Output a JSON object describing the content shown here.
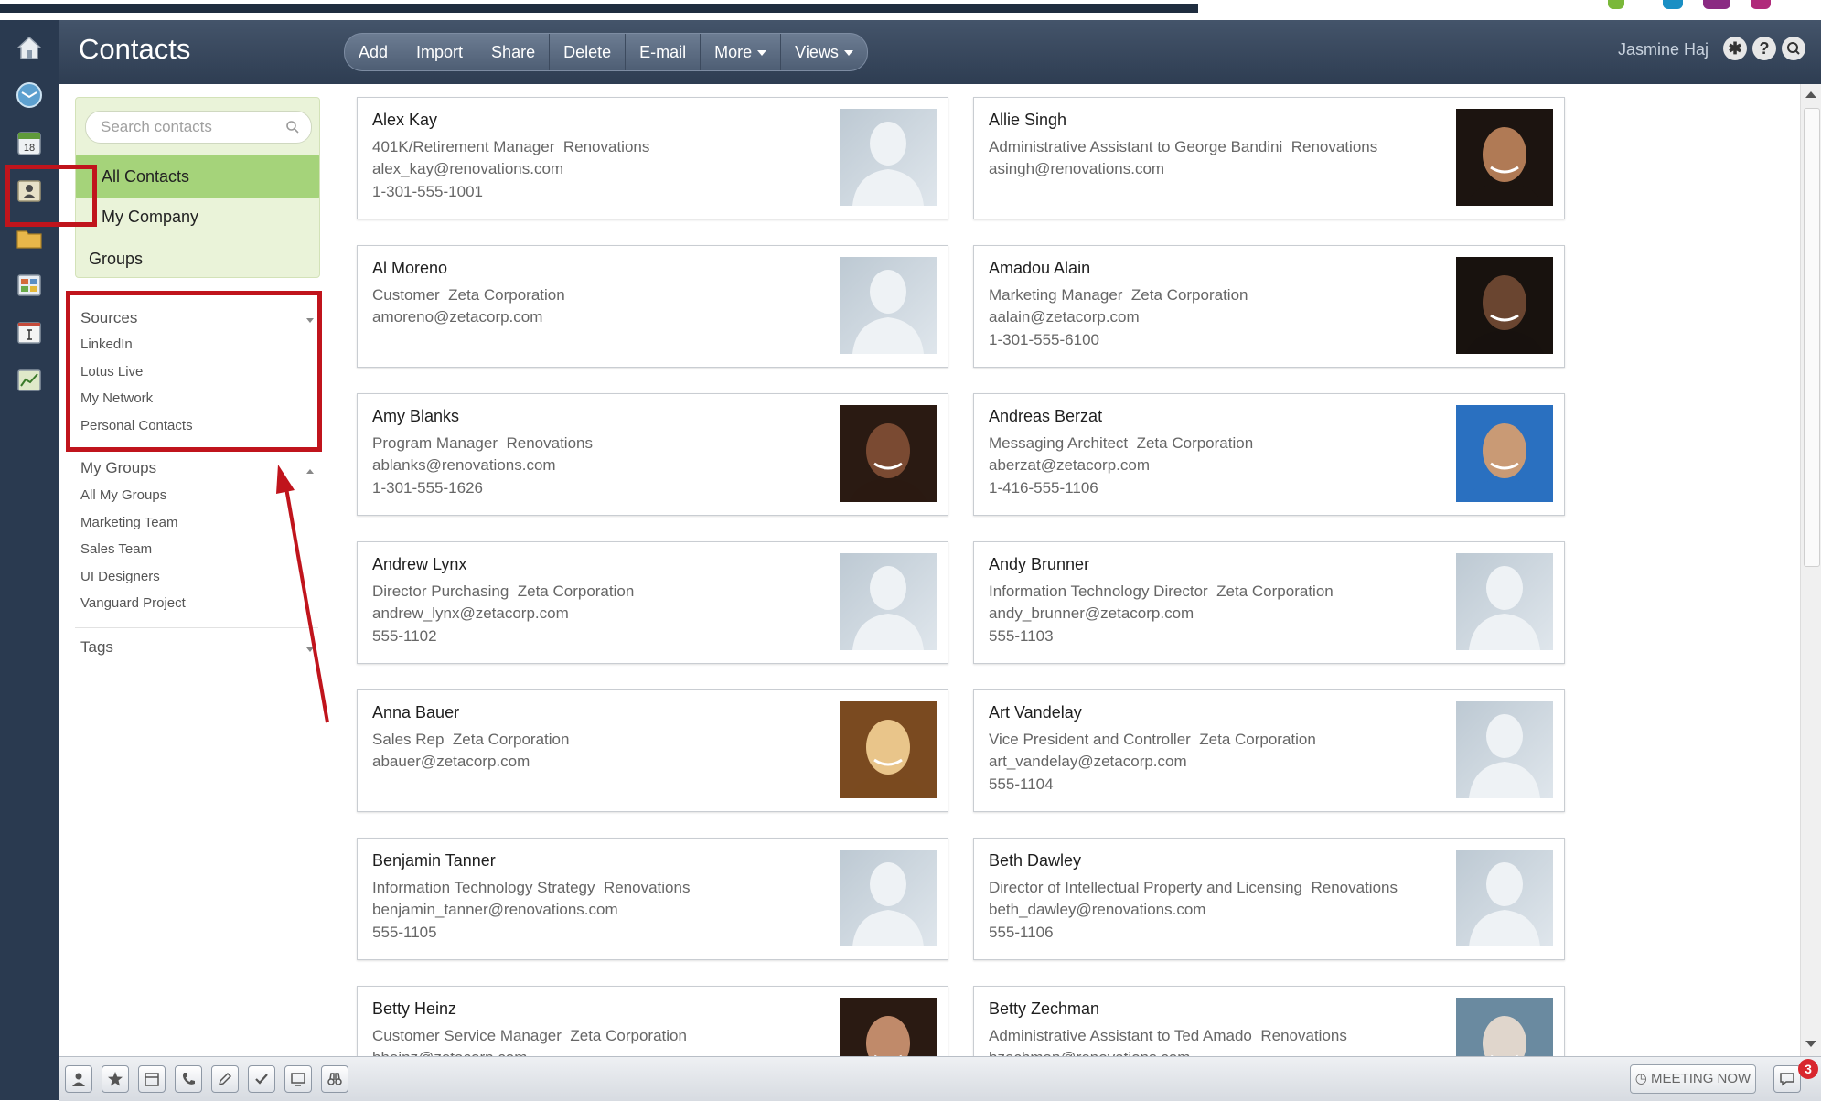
{
  "colors": {
    "header_bg": "#3a4a60",
    "rail_bg": "#2a3a50",
    "nav_selected": "#a5d37a",
    "nav_box_bg": "#eaf3d9",
    "annotation": "#c0141c",
    "badge": "#d8262e"
  },
  "rail": {
    "icons": [
      "home-icon",
      "mail-icon",
      "calendar-icon",
      "contacts-icon",
      "files-icon",
      "activities-icon",
      "forms-icon",
      "charts-icon"
    ],
    "calendar_day": "18"
  },
  "header": {
    "title": "Contacts",
    "toolbar": [
      "Add",
      "Import",
      "Share",
      "Delete",
      "E-mail",
      "More",
      "Views"
    ],
    "user_name": "Jasmine Haj",
    "icons": [
      "settings-icon",
      "help-icon",
      "search-icon"
    ]
  },
  "sidebar": {
    "search_placeholder": "Search contacts",
    "nav": {
      "all_contacts": "All Contacts",
      "my_company": "My Company",
      "groups": "Groups"
    },
    "sources": {
      "title": "Sources",
      "items": [
        "LinkedIn",
        "Lotus Live",
        "My Network",
        "Personal Contacts"
      ]
    },
    "my_groups": {
      "title": "My Groups",
      "items": [
        "All My Groups",
        "Marketing Team",
        "Sales Team",
        "UI Designers",
        "Vanguard Project"
      ]
    },
    "tags": {
      "title": "Tags"
    }
  },
  "contacts": [
    {
      "name": "Alex Kay",
      "title": "401K/Retirement Manager",
      "company": "Renovations",
      "email": "alex_kay@renovations.com",
      "phone": "1-301-555-1001",
      "photo": "placeholder"
    },
    {
      "name": "Allie Singh",
      "title": "Administrative Assistant to George Bandini",
      "company": "Renovations",
      "email": "asingh@renovations.com",
      "phone": "",
      "photo": "portrait-woman-dark-hair"
    },
    {
      "name": "Al Moreno",
      "title": "Customer",
      "company": "Zeta Corporation",
      "email": "amoreno@zetacorp.com",
      "phone": "",
      "photo": "placeholder"
    },
    {
      "name": "Amadou Alain",
      "title": "Marketing Manager",
      "company": "Zeta Corporation",
      "email": "aalain@zetacorp.com",
      "phone": "1-301-555-6100",
      "photo": "portrait-man-bald"
    },
    {
      "name": "Amy Blanks",
      "title": "Program Manager",
      "company": "Renovations",
      "email": "ablanks@renovations.com",
      "phone": "1-301-555-1626",
      "photo": "portrait-woman-smiling"
    },
    {
      "name": "Andreas Berzat",
      "title": "Messaging Architect",
      "company": "Zeta Corporation",
      "email": "aberzat@zetacorp.com",
      "phone": "1-416-555-1106",
      "photo": "portrait-man-blue-bg"
    },
    {
      "name": "Andrew Lynx",
      "title": "Director Purchasing",
      "company": "Zeta Corporation",
      "email": "andrew_lynx@zetacorp.com",
      "phone": "555-1102",
      "photo": "placeholder"
    },
    {
      "name": "Andy Brunner",
      "title": "Information Technology Director",
      "company": "Zeta Corporation",
      "email": "andy_brunner@zetacorp.com",
      "phone": "555-1103",
      "photo": "placeholder"
    },
    {
      "name": "Anna Bauer",
      "title": "Sales Rep",
      "company": "Zeta Corporation",
      "email": "abauer@zetacorp.com",
      "phone": "",
      "photo": "portrait-woman-blonde"
    },
    {
      "name": "Art Vandelay",
      "title": "Vice President and Controller",
      "company": "Zeta Corporation",
      "email": "art_vandelay@zetacorp.com",
      "phone": "555-1104",
      "photo": "placeholder"
    },
    {
      "name": "Benjamin Tanner",
      "title": "Information Technology Strategy",
      "company": "Renovations",
      "email": "benjamin_tanner@renovations.com",
      "phone": "555-1105",
      "photo": "placeholder"
    },
    {
      "name": "Beth Dawley",
      "title": "Director of Intellectual Property and Licensing",
      "company": "Renovations",
      "email": "beth_dawley@renovations.com",
      "phone": "555-1106",
      "photo": "placeholder"
    },
    {
      "name": "Betty Heinz",
      "title": "Customer Service Manager",
      "company": "Zeta Corporation",
      "email": "bheinz@zetacorp.com",
      "phone": "",
      "photo": "portrait-woman-brunette"
    },
    {
      "name": "Betty Zechman",
      "title": "Administrative Assistant to Ted Amado",
      "company": "Renovations",
      "email": "bzechman@renovations.com",
      "phone": "",
      "photo": "portrait-woman-grey-hair"
    }
  ],
  "bottombar": {
    "icons": [
      "person-icon",
      "star-icon",
      "calendar-small-icon",
      "phone-icon",
      "pencil-icon",
      "checkbox-icon",
      "screen-icon",
      "binoculars-icon"
    ],
    "meeting_label": "MEETING NOW",
    "notification_count": "3"
  }
}
